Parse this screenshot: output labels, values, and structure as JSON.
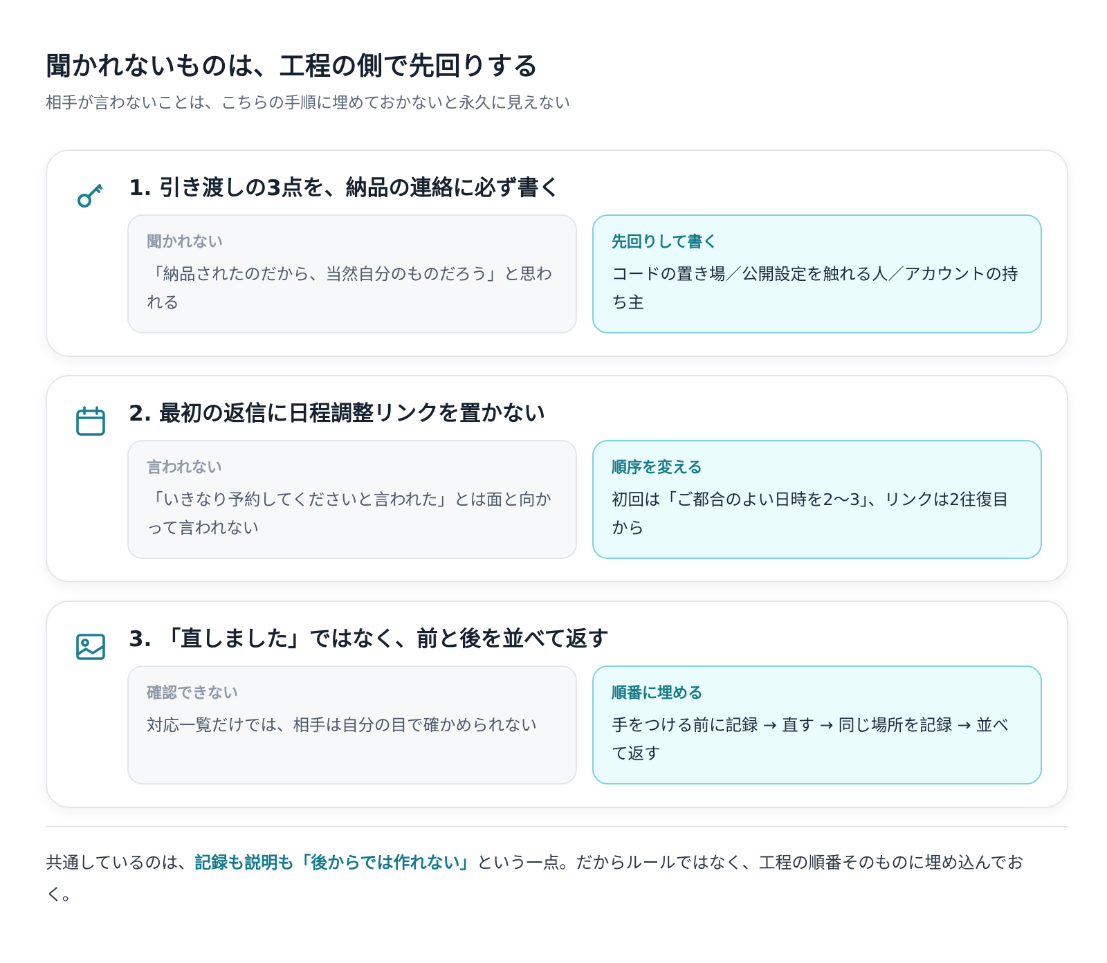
{
  "header": {
    "title": "聞かれないものは、工程の側で先回りする",
    "subtitle": "相手が言わないことは、こちらの手順に埋めておかないと永久に見えない"
  },
  "cards": [
    {
      "icon": "key-icon",
      "title": "1. 引き渡しの3点を、納品の連絡に必ず書く",
      "before": {
        "label": "聞かれない",
        "text": "「納品されたのだから、当然自分のものだろう」と思われる"
      },
      "after": {
        "label": "先回りして書く",
        "text": "コードの置き場／公開設定を触れる人／アカウントの持ち主"
      }
    },
    {
      "icon": "calendar-icon",
      "title": "2. 最初の返信に日程調整リンクを置かない",
      "before": {
        "label": "言われない",
        "text": "「いきなり予約してくださいと言われた」とは面と向かって言われない"
      },
      "after": {
        "label": "順序を変える",
        "text": "初回は「ご都合のよい日時を2〜3」、リンクは2往復目から"
      }
    },
    {
      "icon": "image-icon",
      "title": "3. 「直しました」ではなく、前と後を並べて返す",
      "before": {
        "label": "確認できない",
        "text": "対応一覧だけでは、相手は自分の目で確かめられない"
      },
      "after": {
        "label": "順番に埋める",
        "text": "手をつける前に記録 → 直す → 同じ場所を記録 → 並べて返す"
      }
    }
  ],
  "summary": {
    "prefix": "共通しているのは、",
    "highlight": "記録も説明も「後からでは作れない」",
    "suffix": "という一点。だからルールではなく、工程の順番そのものに埋め込んでおく。"
  },
  "colors": {
    "accent": "#147a8b",
    "after_bg": "#ebfcfd",
    "after_border": "#7fd3dc",
    "before_bg": "#f7f8fa"
  }
}
